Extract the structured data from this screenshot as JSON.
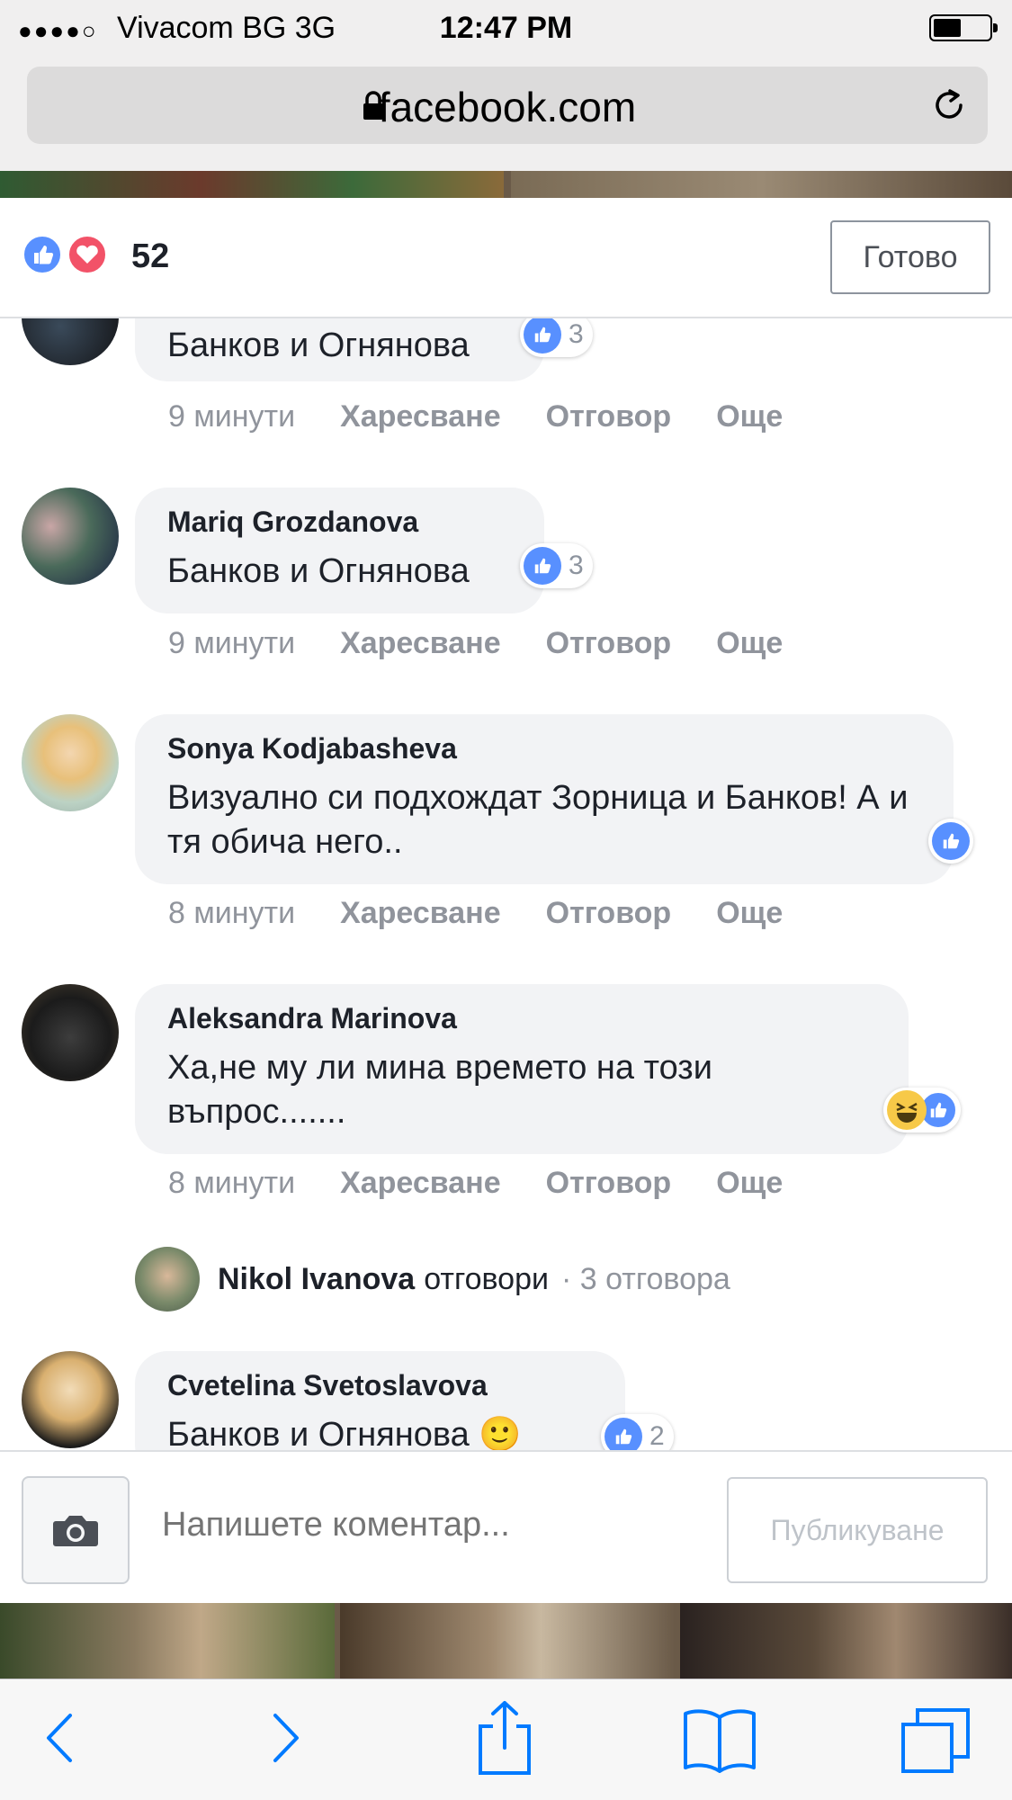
{
  "status_bar": {
    "signal": "●●●●○",
    "carrier": "Vivacom BG   3G",
    "time": "12:47 PM"
  },
  "browser": {
    "url": "facebook.com"
  },
  "reactions_header": {
    "count": "52",
    "done_label": "Готово"
  },
  "comments": [
    {
      "author": "",
      "text": "Банков и Огнянова",
      "reaction_count": "3",
      "time": "9 минути",
      "like": "Харесване",
      "reply": "Отговор",
      "more": "Още"
    },
    {
      "author": "Mariq Grozdanova",
      "text": "Банков и Огнянова",
      "reaction_count": "3",
      "time": "9 минути",
      "like": "Харесване",
      "reply": "Отговор",
      "more": "Още"
    },
    {
      "author": "Sonya Kodjabasheva",
      "text": "Визуално си подхождат Зорница и Банков! А и тя обича него..",
      "time": "8 минути",
      "like": "Харесване",
      "reply": "Отговор",
      "more": "Още"
    },
    {
      "author": "Aleksandra Marinova",
      "text": "Ха,не му ли мина времето на този въпрос.......",
      "time": "8 минути",
      "like": "Харесване",
      "reply": "Отговор",
      "more": "Още",
      "reply_preview": {
        "name": "Nikol Ivanova",
        "verb": "отговори",
        "count": "· 3 отговора"
      }
    },
    {
      "author": "Cvetelina Svetoslavova",
      "text": "Банков и Огнянова 🙂",
      "reaction_count": "2"
    }
  ],
  "composer": {
    "placeholder": "Напишете коментар...",
    "post_label": "Публикуване"
  },
  "toolbar": {
    "icons": [
      "back-icon",
      "forward-icon",
      "share-icon",
      "bookmarks-icon",
      "tabs-icon"
    ]
  },
  "colors": {
    "accent_blue": "#5890ff",
    "love_red": "#f25268",
    "bubble_gray": "#f2f3f5",
    "meta_gray": "#90949c",
    "ios_blue": "#007aff"
  }
}
